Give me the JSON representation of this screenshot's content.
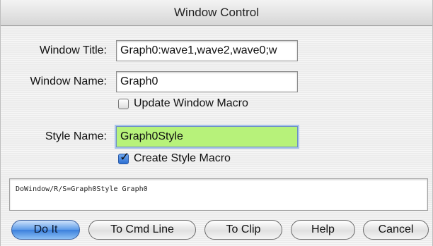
{
  "window": {
    "title": "Window Control"
  },
  "form": {
    "window_title_label": "Window Title:",
    "window_title_value": "Graph0:wave1,wave2,wave0;w",
    "window_name_label": "Window Name:",
    "window_name_value": "Graph0",
    "update_macro_label": "Update Window Macro",
    "update_macro_checked": false,
    "style_name_label": "Style Name:",
    "style_name_value": "Graph0Style",
    "create_style_label": "Create Style Macro",
    "create_style_checked": true
  },
  "command": {
    "text": "DoWindow/R/S=Graph0Style Graph0"
  },
  "buttons": {
    "do_it": "Do It",
    "to_cmd_line": "To Cmd Line",
    "to_clip": "To Clip",
    "help": "Help",
    "cancel": "Cancel"
  },
  "colors": {
    "style_field_bg": "#b7f27a",
    "default_button": "#3b7fdc"
  }
}
